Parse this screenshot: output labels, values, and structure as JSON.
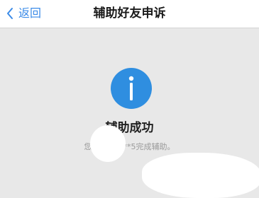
{
  "header": {
    "back_label": "返回",
    "title": "辅助好友申诉"
  },
  "result": {
    "icon": "info-icon",
    "title": "辅助成功",
    "subtitle": "您已帮******5完成辅助。"
  },
  "colors": {
    "accent": "#3b8be8",
    "icon_bg": "#2f8ee0",
    "page_bg": "#e8e8e8"
  }
}
